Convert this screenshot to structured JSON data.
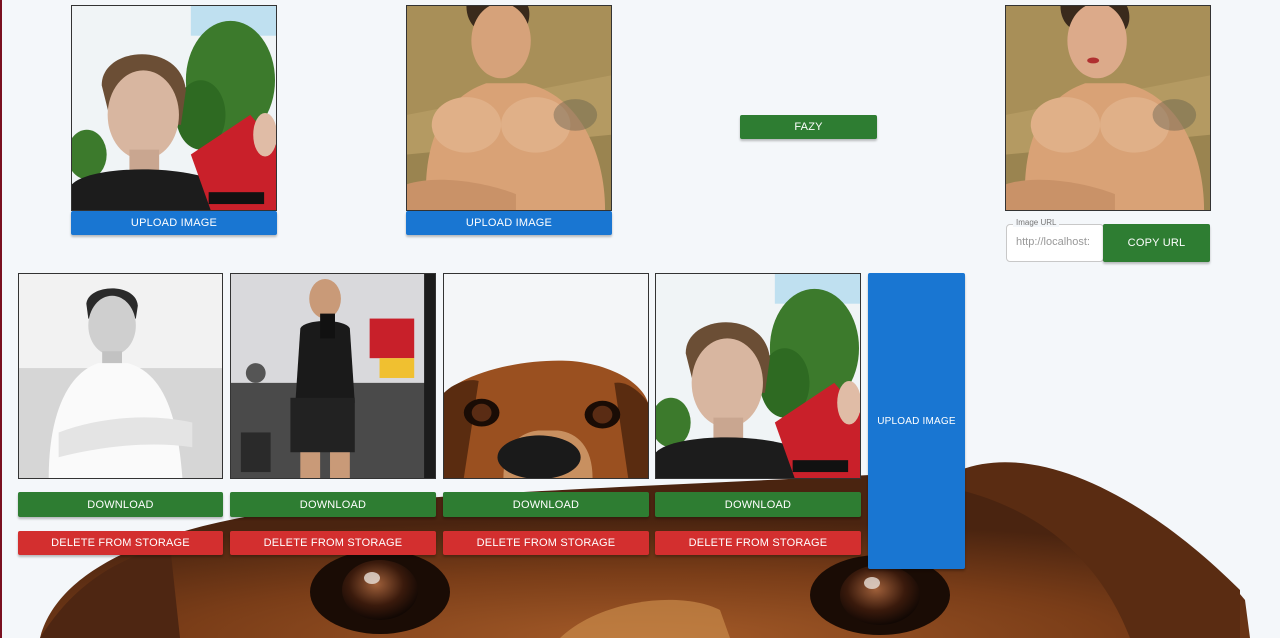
{
  "top_row": {
    "source_upload_label": "UPLOAD IMAGE",
    "target_upload_label": "UPLOAD IMAGE",
    "action_label": "FAZY"
  },
  "result": {
    "url_field_label": "Image URL",
    "url_value": "http://localhost:",
    "copy_label": "COPY URL"
  },
  "gallery": {
    "items": [
      {
        "image": "man-white-shirt-photo",
        "download_label": "DOWNLOAD",
        "delete_label": "DELETE FROM STORAGE"
      },
      {
        "image": "gym-mirror-selfie-photo",
        "download_label": "DOWNLOAD",
        "delete_label": "DELETE FROM STORAGE"
      },
      {
        "image": "dog-closeup-photo",
        "download_label": "DOWNLOAD",
        "delete_label": "DELETE FROM STORAGE"
      },
      {
        "image": "selfie-red-packet-photo",
        "download_label": "DOWNLOAD",
        "delete_label": "DELETE FROM STORAGE"
      }
    ],
    "upload_label": "UPLOAD IMAGE"
  },
  "colors": {
    "primary_blue": "#1976d2",
    "success_green": "#2e7d32",
    "danger_red": "#d32f2f"
  }
}
